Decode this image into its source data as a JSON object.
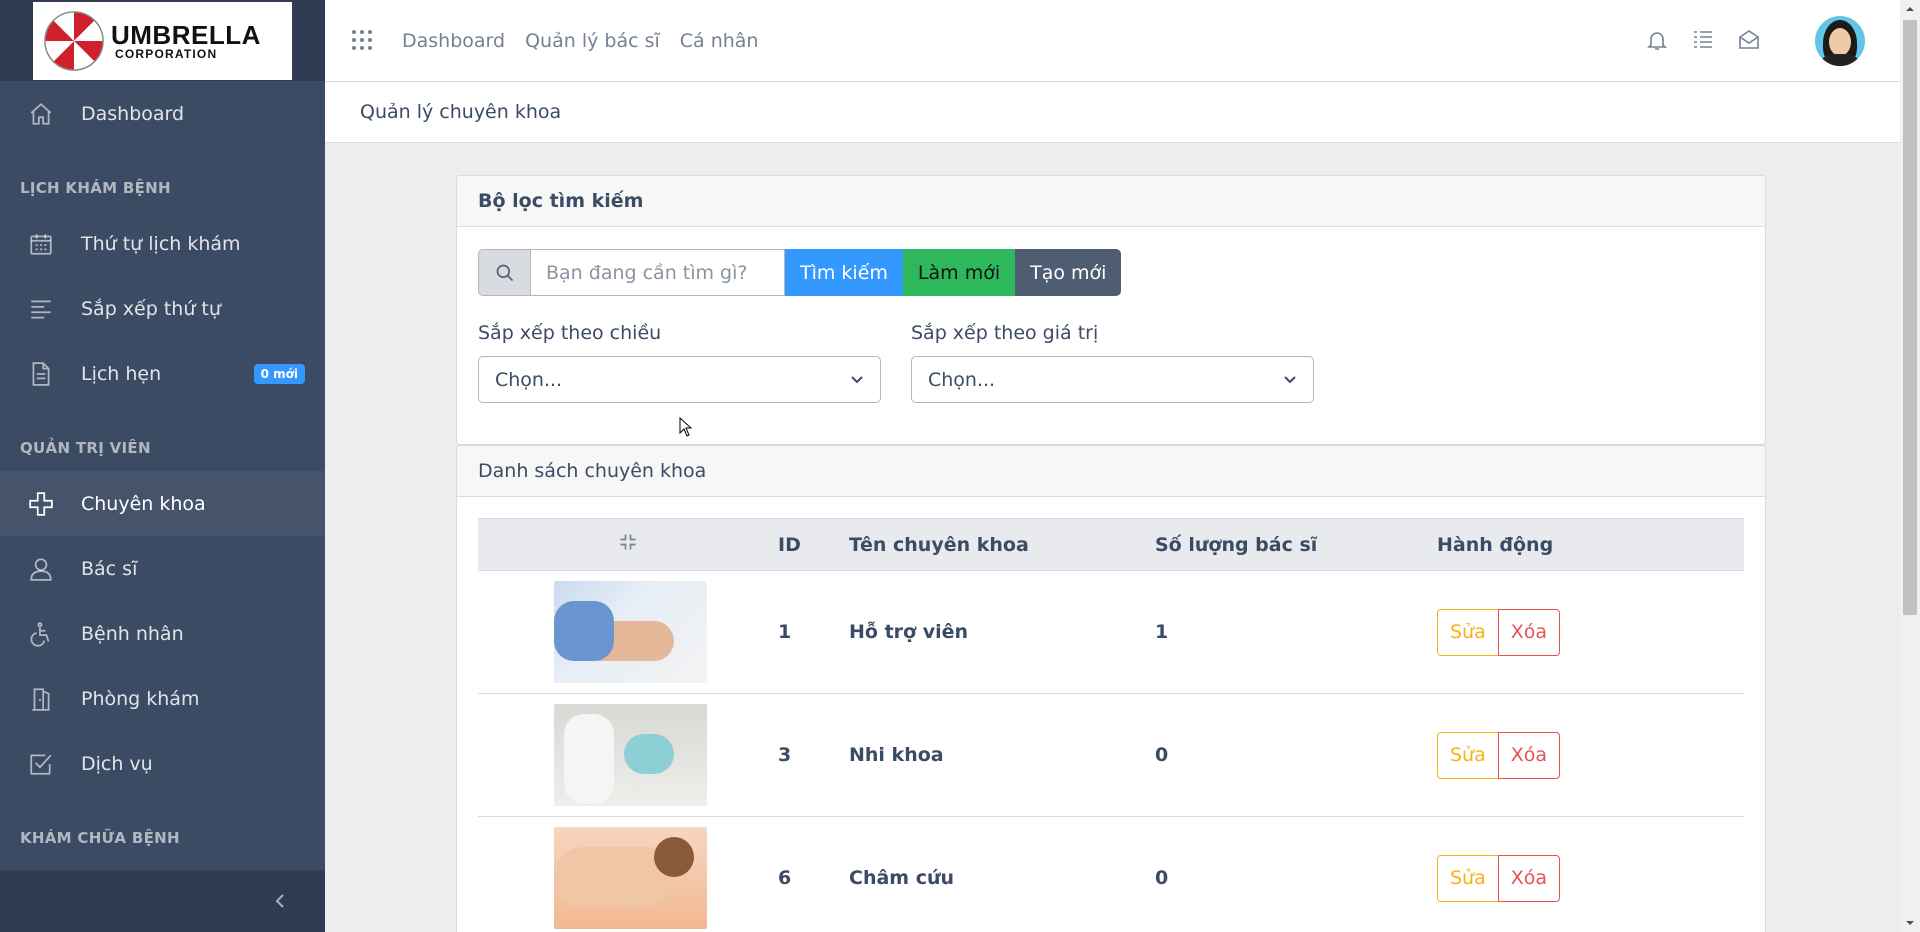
{
  "brand": {
    "name": "UMBRELLA",
    "sub": "CORPORATION"
  },
  "sidebar": {
    "items": [
      {
        "label": "Dashboard",
        "icon": "home-icon"
      },
      {
        "section": "LỊCH KHÁM BỆNH"
      },
      {
        "label": "Thứ tự lịch khám",
        "icon": "calendar-icon"
      },
      {
        "label": "Sắp xếp thứ tự",
        "icon": "list-icon"
      },
      {
        "label": "Lịch hẹn",
        "icon": "document-icon",
        "badge": "0 mới"
      },
      {
        "section": "QUẢN TRỊ VIÊN"
      },
      {
        "label": "Chuyên khoa",
        "icon": "plus-icon",
        "active": true
      },
      {
        "label": "Bác sĩ",
        "icon": "people-icon"
      },
      {
        "label": "Bệnh nhân",
        "icon": "wheelchair-icon"
      },
      {
        "label": "Phòng khám",
        "icon": "door-icon"
      },
      {
        "label": "Dịch vụ",
        "icon": "check-square-icon"
      },
      {
        "section": "KHÁM CHỮA BỆNH"
      }
    ]
  },
  "header": {
    "links": [
      "Dashboard",
      "Quản lý bác sĩ",
      "Cá nhân"
    ],
    "icons": [
      "bell-icon",
      "task-list-icon",
      "envelope-icon"
    ]
  },
  "breadcrumb": "Quản lý chuyên khoa",
  "filter": {
    "title": "Bộ lọc tìm kiếm",
    "search_placeholder": "Bạn đang cần tìm gì?",
    "search_label": "Tìm kiếm",
    "refresh_label": "Làm mới",
    "create_label": "Tạo mới",
    "sort_direction_label": "Sắp xếp theo chiều",
    "sort_direction_value": "Chọn...",
    "sort_value_label": "Sắp xếp theo giá trị",
    "sort_value_value": "Chọn..."
  },
  "list": {
    "title": "Danh sách chuyên khoa",
    "columns": [
      "",
      "ID",
      "Tên chuyên khoa",
      "Số lượng bác sĩ",
      "Hành động"
    ],
    "rows": [
      {
        "id": "1",
        "name": "Hỗ trợ viên",
        "doctors": "1"
      },
      {
        "id": "3",
        "name": "Nhi khoa",
        "doctors": "0"
      },
      {
        "id": "6",
        "name": "Châm cứu",
        "doctors": "0"
      }
    ],
    "edit_label": "Sửa",
    "delete_label": "Xóa"
  },
  "colors": {
    "sidebar": "#3c4b64",
    "primary": "#3399ff",
    "success": "#2eb85c",
    "dark": "#4f5d73",
    "warning": "#f9b115",
    "danger": "#e55353"
  }
}
